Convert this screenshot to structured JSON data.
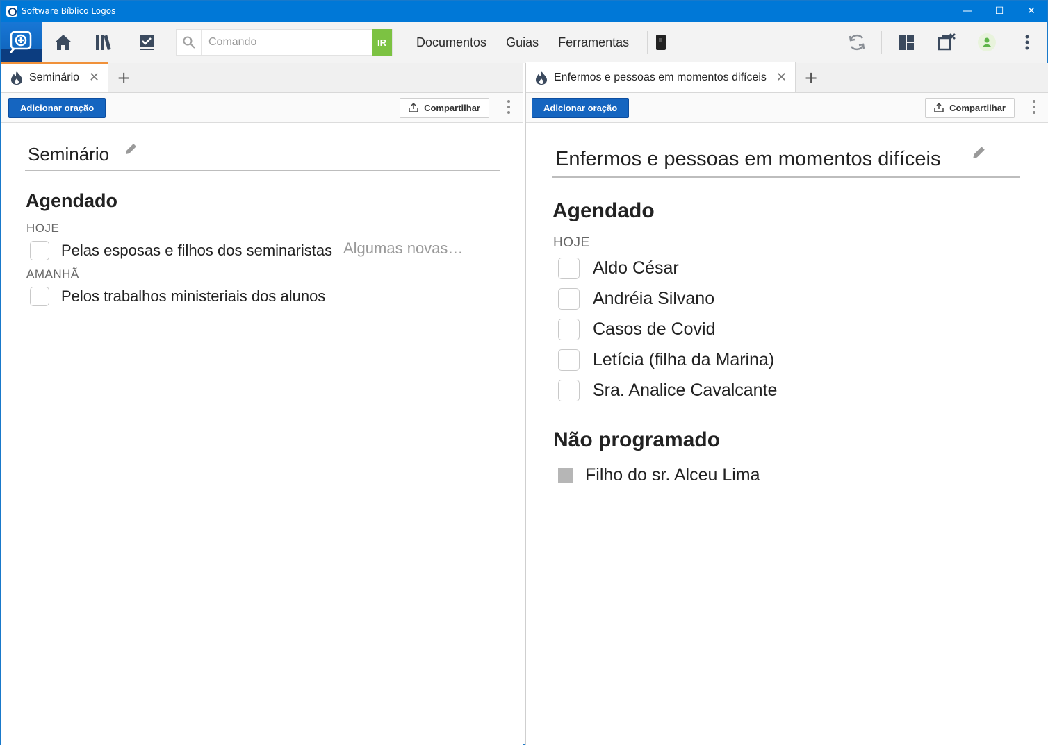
{
  "window": {
    "title": "Software Bíblico Logos",
    "controls": [
      "—",
      "☐",
      "✕"
    ]
  },
  "toolbar": {
    "icons": [
      "logos-search-icon",
      "home-icon",
      "library-icon",
      "checklist-icon"
    ],
    "search_placeholder": "Comando",
    "go_label": "IR",
    "menu": [
      "Documentos",
      "Guias",
      "Ferramentas"
    ],
    "right_icons": [
      "sync-icon",
      "layouts-icon",
      "close-windows-icon",
      "account-icon",
      "more-icon"
    ],
    "colors": {
      "accent": "#1565c0",
      "go": "#7cc242",
      "title_bar": "#0078d7"
    }
  },
  "left_panel": {
    "tab_label": "Seminário",
    "add_button": "Adicionar oração",
    "share_button": "Compartilhar",
    "list_title": "Seminário",
    "sections": [
      {
        "heading": "Agendado",
        "groups": [
          {
            "day": "HOJE",
            "items": [
              {
                "text": "Pelas esposas e filhos dos seminaristas",
                "note": "Algumas novas…"
              }
            ]
          },
          {
            "day": "AMANHÃ",
            "items": [
              {
                "text": "Pelos trabalhos ministeriais dos alunos"
              }
            ]
          }
        ]
      }
    ]
  },
  "right_panel": {
    "tab_label": "Enfermos e pessoas em momentos difíceis",
    "add_button": "Adicionar oração",
    "share_button": "Compartilhar",
    "list_title": "Enfermos e pessoas em momentos difíceis",
    "sections": [
      {
        "heading": "Agendado",
        "day": "HOJE",
        "items": [
          "Aldo César",
          "Andréia Silvano",
          "Casos de Covid",
          "Letícia (filha da Marina)",
          "Sra. Analice Cavalcante"
        ]
      },
      {
        "heading": "Não programado",
        "items": [
          "Filho do sr. Alceu Lima"
        ]
      }
    ]
  }
}
